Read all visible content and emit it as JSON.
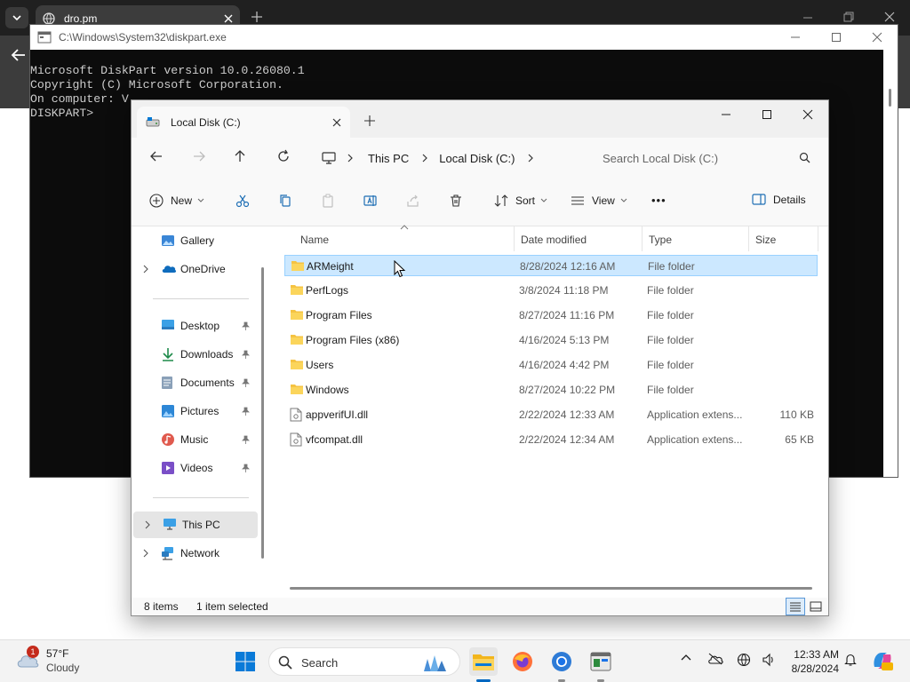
{
  "browser": {
    "tab_title": "dro.pm"
  },
  "console": {
    "title": "C:\\Windows\\System32\\diskpart.exe",
    "lines": [
      "Microsoft DiskPart version 10.0.26080.1",
      "",
      "Copyright (C) Microsoft Corporation.",
      "On computer: V",
      "",
      "DISKPART>"
    ]
  },
  "explorer": {
    "tab_title": "Local Disk (C:)",
    "breadcrumb": [
      "This PC",
      "Local Disk (C:)"
    ],
    "search_placeholder": "Search Local Disk (C:)",
    "commands": {
      "new": "New",
      "sort": "Sort",
      "view": "View",
      "more": "•••",
      "details": "Details"
    },
    "sidebar": [
      {
        "label": "Gallery",
        "icon": "gallery-icon",
        "expandable": false,
        "pinned": false
      },
      {
        "label": "OneDrive",
        "icon": "onedrive-icon",
        "expandable": true,
        "pinned": false
      },
      {
        "label": "Desktop",
        "icon": "desktop-icon",
        "expandable": false,
        "pinned": true
      },
      {
        "label": "Downloads",
        "icon": "downloads-icon",
        "expandable": false,
        "pinned": true
      },
      {
        "label": "Documents",
        "icon": "documents-icon",
        "expandable": false,
        "pinned": true
      },
      {
        "label": "Pictures",
        "icon": "pictures-icon",
        "expandable": false,
        "pinned": true
      },
      {
        "label": "Music",
        "icon": "music-icon",
        "expandable": false,
        "pinned": true
      },
      {
        "label": "Videos",
        "icon": "videos-icon",
        "expandable": false,
        "pinned": true
      },
      {
        "label": "This PC",
        "icon": "this-pc-icon",
        "expandable": true,
        "pinned": false,
        "selected": true
      },
      {
        "label": "Network",
        "icon": "network-icon",
        "expandable": true,
        "pinned": false
      }
    ],
    "columns": {
      "name": "Name",
      "date": "Date modified",
      "type": "Type",
      "size": "Size"
    },
    "files": [
      {
        "name": "ARMeight",
        "date": "8/28/2024 12:16 AM",
        "type": "File folder",
        "size": "",
        "kind": "folder",
        "selected": true
      },
      {
        "name": "PerfLogs",
        "date": "3/8/2024 11:18 PM",
        "type": "File folder",
        "size": "",
        "kind": "folder"
      },
      {
        "name": "Program Files",
        "date": "8/27/2024 11:16 PM",
        "type": "File folder",
        "size": "",
        "kind": "folder"
      },
      {
        "name": "Program Files (x86)",
        "date": "4/16/2024 5:13 PM",
        "type": "File folder",
        "size": "",
        "kind": "folder"
      },
      {
        "name": "Users",
        "date": "4/16/2024 4:42 PM",
        "type": "File folder",
        "size": "",
        "kind": "folder"
      },
      {
        "name": "Windows",
        "date": "8/27/2024 10:22 PM",
        "type": "File folder",
        "size": "",
        "kind": "folder"
      },
      {
        "name": "appverifUI.dll",
        "date": "2/22/2024 12:33 AM",
        "type": "Application extens...",
        "size": "110 KB",
        "kind": "dll"
      },
      {
        "name": "vfcompat.dll",
        "date": "2/22/2024 12:34 AM",
        "type": "Application extens...",
        "size": "65 KB",
        "kind": "dll"
      }
    ],
    "status": {
      "items": "8 items",
      "selected": "1 item selected"
    }
  },
  "taskbar": {
    "weather_temp": "57°F",
    "weather_cond": "Cloudy",
    "weather_badge": "1",
    "search_label": "Search",
    "time": "12:33 AM",
    "date": "8/28/2024"
  },
  "colors": {
    "selection_bg": "#cce8ff",
    "selection_border": "#99d1ff",
    "folder_yellow": "#f5c342",
    "accent_blue": "#0067c0"
  }
}
